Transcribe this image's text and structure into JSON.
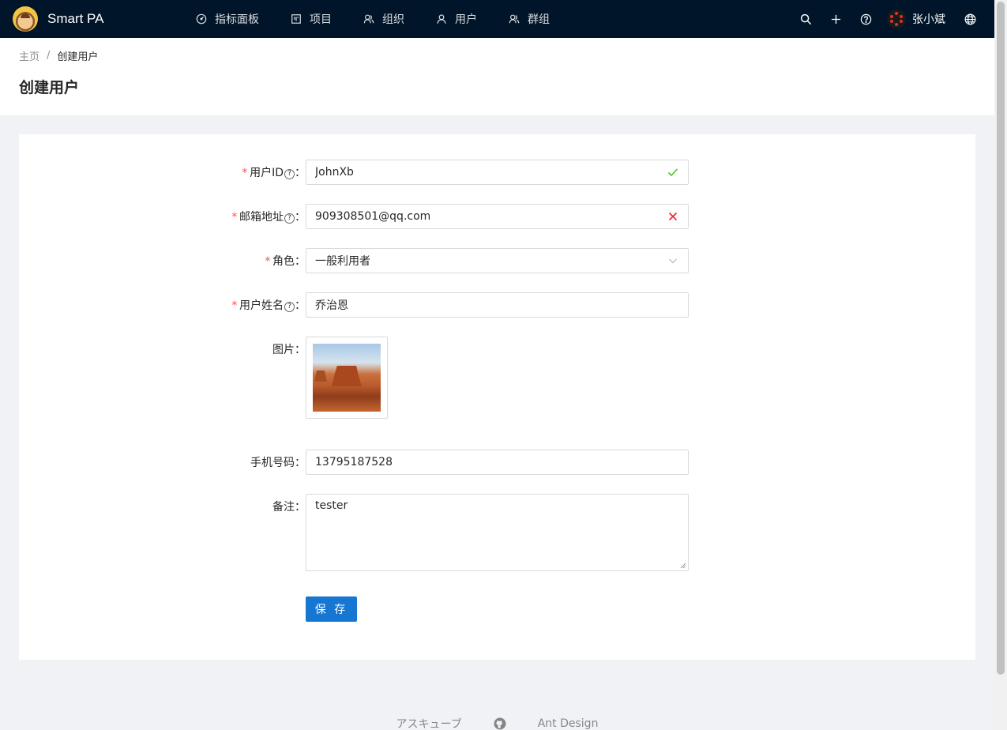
{
  "app": {
    "title": "Smart PA"
  },
  "nav": [
    {
      "label": "指标面板",
      "icon": "dashboard-icon"
    },
    {
      "label": "项目",
      "icon": "project-icon"
    },
    {
      "label": "组织",
      "icon": "team-icon"
    },
    {
      "label": "用户",
      "icon": "user-icon"
    },
    {
      "label": "群组",
      "icon": "group-icon"
    }
  ],
  "header_right": {
    "user_name": "张小斌"
  },
  "breadcrumb": {
    "home": "主页",
    "separator": "/",
    "current": "创建用户"
  },
  "page": {
    "title": "创建用户"
  },
  "form": {
    "user_id": {
      "label": "用户ID",
      "value": "JohnXb",
      "required": true,
      "status": "success"
    },
    "email": {
      "label": "邮箱地址",
      "value": "909308501@qq.com",
      "required": true,
      "status": "error"
    },
    "role": {
      "label": "角色",
      "value": "一般利用者",
      "required": true
    },
    "user_name": {
      "label": "用户姓名",
      "value": "乔治恩",
      "required": true
    },
    "image": {
      "label": "图片"
    },
    "phone": {
      "label": "手机号码",
      "value": "13795187528"
    },
    "note": {
      "label": "备注",
      "value": "tester"
    },
    "colon": "：",
    "required_mark": "*",
    "help_mark": "?",
    "submit_label": "保 存"
  },
  "footer": {
    "links": [
      "アスキューブ",
      "Ant Design"
    ],
    "github_icon": "github-icon"
  },
  "colors": {
    "header_bg": "#001529",
    "primary": "#1677d2",
    "success": "#52c41a",
    "error": "#f5222d"
  }
}
